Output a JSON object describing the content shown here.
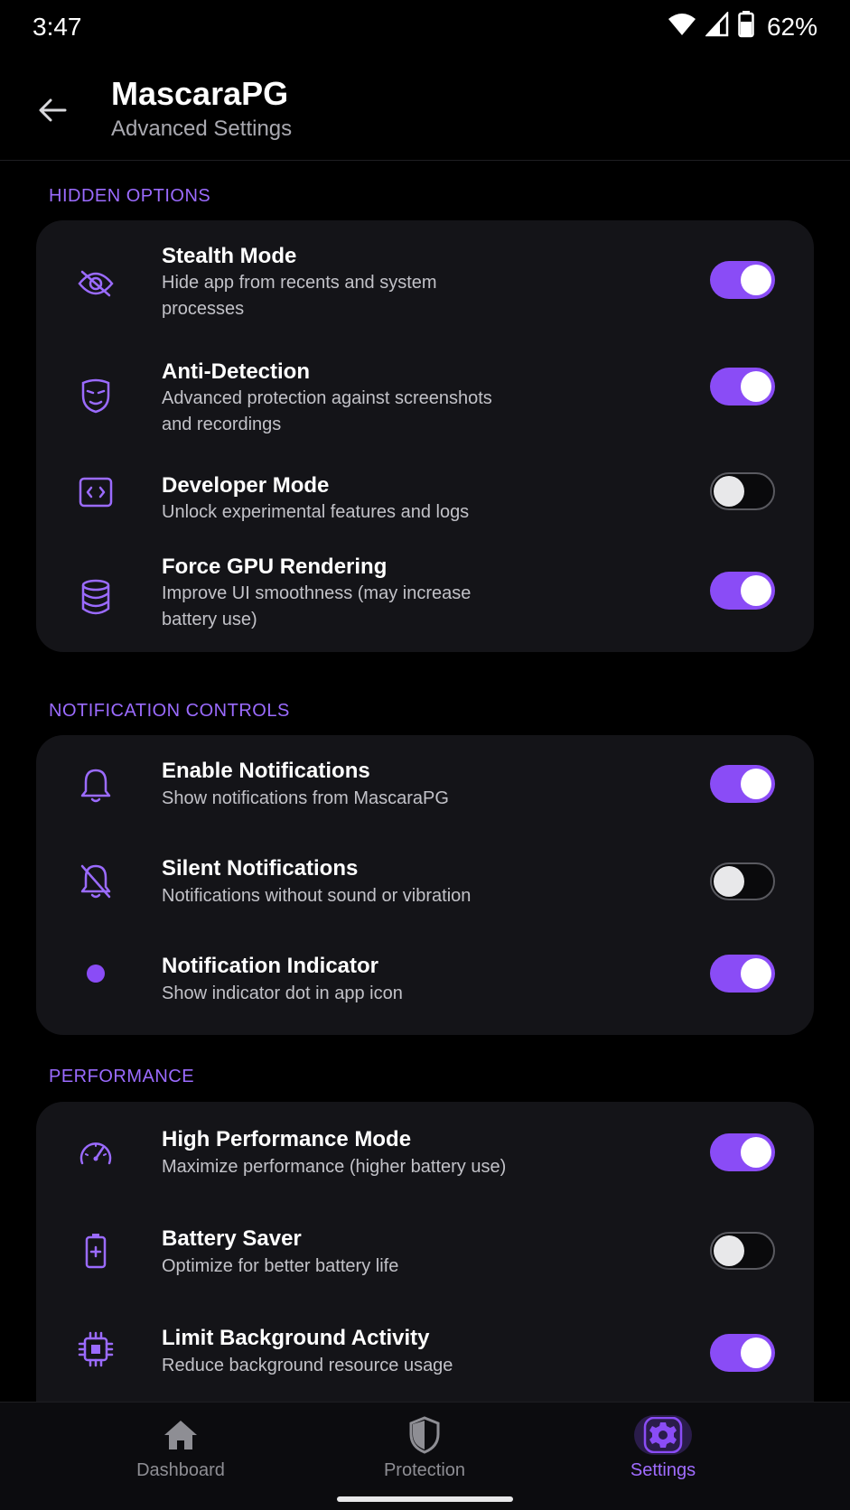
{
  "status": {
    "time": "3:47",
    "battery": "62%"
  },
  "header": {
    "title": "MascaraPG",
    "subtitle": "Advanced Settings"
  },
  "sections": [
    {
      "title": "HIDDEN OPTIONS",
      "items": [
        {
          "title": "Stealth Mode",
          "desc": "Hide app from recents and system processes",
          "icon": "eye-off-icon",
          "on": true
        },
        {
          "title": "Anti-Detection",
          "desc": "Advanced protection against screenshots and recordings",
          "icon": "mask-icon",
          "on": true
        },
        {
          "title": "Developer Mode",
          "desc": "Unlock experimental features and logs",
          "icon": "code-icon",
          "on": false
        },
        {
          "title": "Force GPU Rendering",
          "desc": "Improve UI smoothness (may increase battery use)",
          "icon": "database-icon",
          "on": true
        }
      ]
    },
    {
      "title": "NOTIFICATION CONTROLS",
      "items": [
        {
          "title": "Enable Notifications",
          "desc": "Show notifications from MascaraPG",
          "icon": "bell-icon",
          "on": true
        },
        {
          "title": "Silent Notifications",
          "desc": "Notifications without sound or vibration",
          "icon": "bell-off-icon",
          "on": false
        },
        {
          "title": "Notification Indicator",
          "desc": "Show indicator dot in app icon",
          "icon": "dot-icon",
          "on": true
        }
      ]
    },
    {
      "title": "PERFORMANCE",
      "items": [
        {
          "title": "High Performance Mode",
          "desc": "Maximize performance (higher battery use)",
          "icon": "speedometer-icon",
          "on": true
        },
        {
          "title": "Battery Saver",
          "desc": "Optimize for better battery life",
          "icon": "battery-icon",
          "on": false
        },
        {
          "title": "Limit Background Activity",
          "desc": "Reduce background resource usage",
          "icon": "chip-icon",
          "on": true
        }
      ]
    }
  ],
  "nav": [
    {
      "label": "Dashboard",
      "icon": "home-icon",
      "active": false
    },
    {
      "label": "Protection",
      "icon": "shield-icon",
      "active": false
    },
    {
      "label": "Settings",
      "icon": "gear-icon",
      "active": true
    }
  ],
  "colors": {
    "accent": "#8a4cf6",
    "section_header": "#9b6bff",
    "card": "#141418",
    "background": "#000000"
  }
}
